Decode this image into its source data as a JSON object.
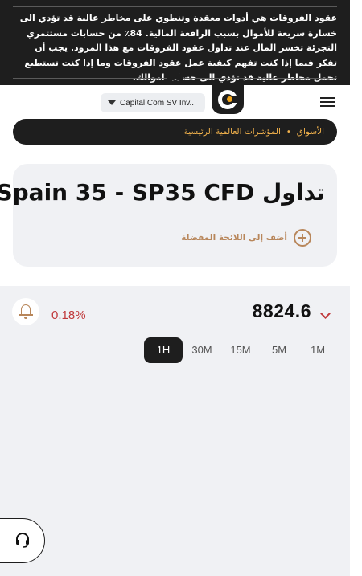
{
  "risk_warning": {
    "text": "عقود الفروقات هي أدوات معقدة وتنطوي على مخاطر عالية قد تؤدي الى خسارة سريعة للأموال بسبب الرافعة المالية. 84٪ من حسابات مستثمري التجزئة تخسر المال عند تداول عقود الفروقات مع هذا المزود. يجب أن تفكر فيما إذا كنت تفهم كيفية عمل عقود الفروقات وما إذا كنت تستطيع تحمل مخاطر عالية قد تؤدي الى خسارة اموالك.",
    "toggle_icon": "chevron-up-icon"
  },
  "header": {
    "entity_selector": "Capital Com SV Inv...",
    "logo_icon": "capital-com-logo",
    "menu_icon": "hamburger-menu-icon"
  },
  "breadcrumb": {
    "items": [
      "الأسواق",
      "المؤشرات العالمية الرئيسية"
    ],
    "separator": "•"
  },
  "instrument": {
    "title_prefix": "تداول",
    "title_name": "Spain 35 - SP35 CFD",
    "add_favorite_label": "أضف إلى اللائحة المفضلة"
  },
  "quote": {
    "price": "8824.6",
    "change_percent": "0.18%",
    "change_color": "#c0393b",
    "direction": "down"
  },
  "timeframes": {
    "options": [
      "1H",
      "30M",
      "15M",
      "5M",
      "1M"
    ],
    "selected": "1H"
  },
  "colors": {
    "dark": "#1e1e1e",
    "accent": "#f2b24c",
    "accent_muted": "#b8865a",
    "panel": "#f0f1f4"
  }
}
